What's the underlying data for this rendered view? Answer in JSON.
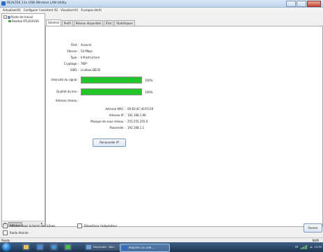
{
  "window": {
    "title": "REALTEK 11n USB Wireless LAN Utility"
  },
  "menu": [
    "Actualiser(R)",
    "Configurer l'assistant (S)",
    "Visualiser(V)",
    "À propos de(A)"
  ],
  "tree": {
    "root": "Poste de travail",
    "child": "Realtek RTL8191SU",
    "expander": "−"
  },
  "tabs": [
    "Général",
    "Profil",
    "Réseau disponible",
    "État",
    "Statistiques"
  ],
  "general": {
    "status_label": "État :",
    "status_value": "Associé",
    "speed_label": "Vitesse :",
    "speed_value": "54 Mbps",
    "type_label": "Type :",
    "type_value": "Infrastructure",
    "encryption_label": "Cryptage :",
    "encryption_value": "TKIP",
    "ssid_label": "SSID :",
    "ssid_value": "Livebox-DECB",
    "signal_label": "Intensité du signal :",
    "signal_percent": 100,
    "signal_text": "100%",
    "quality_label": "Qualité du lien :",
    "quality_percent": 100,
    "quality_text": "100%",
    "network_address_label": "Adresse réseau :",
    "mac_label": "Adresse MAC :",
    "mac_value": "00:E0:4C:40:F0:26",
    "ip_label": "Adresse IP :",
    "ip_value": "192.168.1.96",
    "mask_label": "Masque de sous-réseau :",
    "mask_value": "255.255.255.0",
    "gateway_label": "Passerelle :",
    "gateway_value": "192.168.1.1",
    "renew_button": "Renouveler IP"
  },
  "options": {
    "show_tray": "Afficher dans la barre des icônes",
    "radio_off": "Radio éteinte",
    "disable_adapter": "Désactiver l'adaptateur",
    "check_mark": "✓"
  },
  "close_button": "Fermer",
  "statusbar": {
    "left": "Ready",
    "right": "NUM"
  },
  "taskbar": {
    "tasks": [
      "Document - Wor...",
      "REALTEK 11n USB ..."
    ],
    "tray_lang": "FR",
    "tray_clock": "15:35"
  },
  "colors": {
    "bar_fill": "#22c629",
    "taskbar": "#1d3452"
  }
}
